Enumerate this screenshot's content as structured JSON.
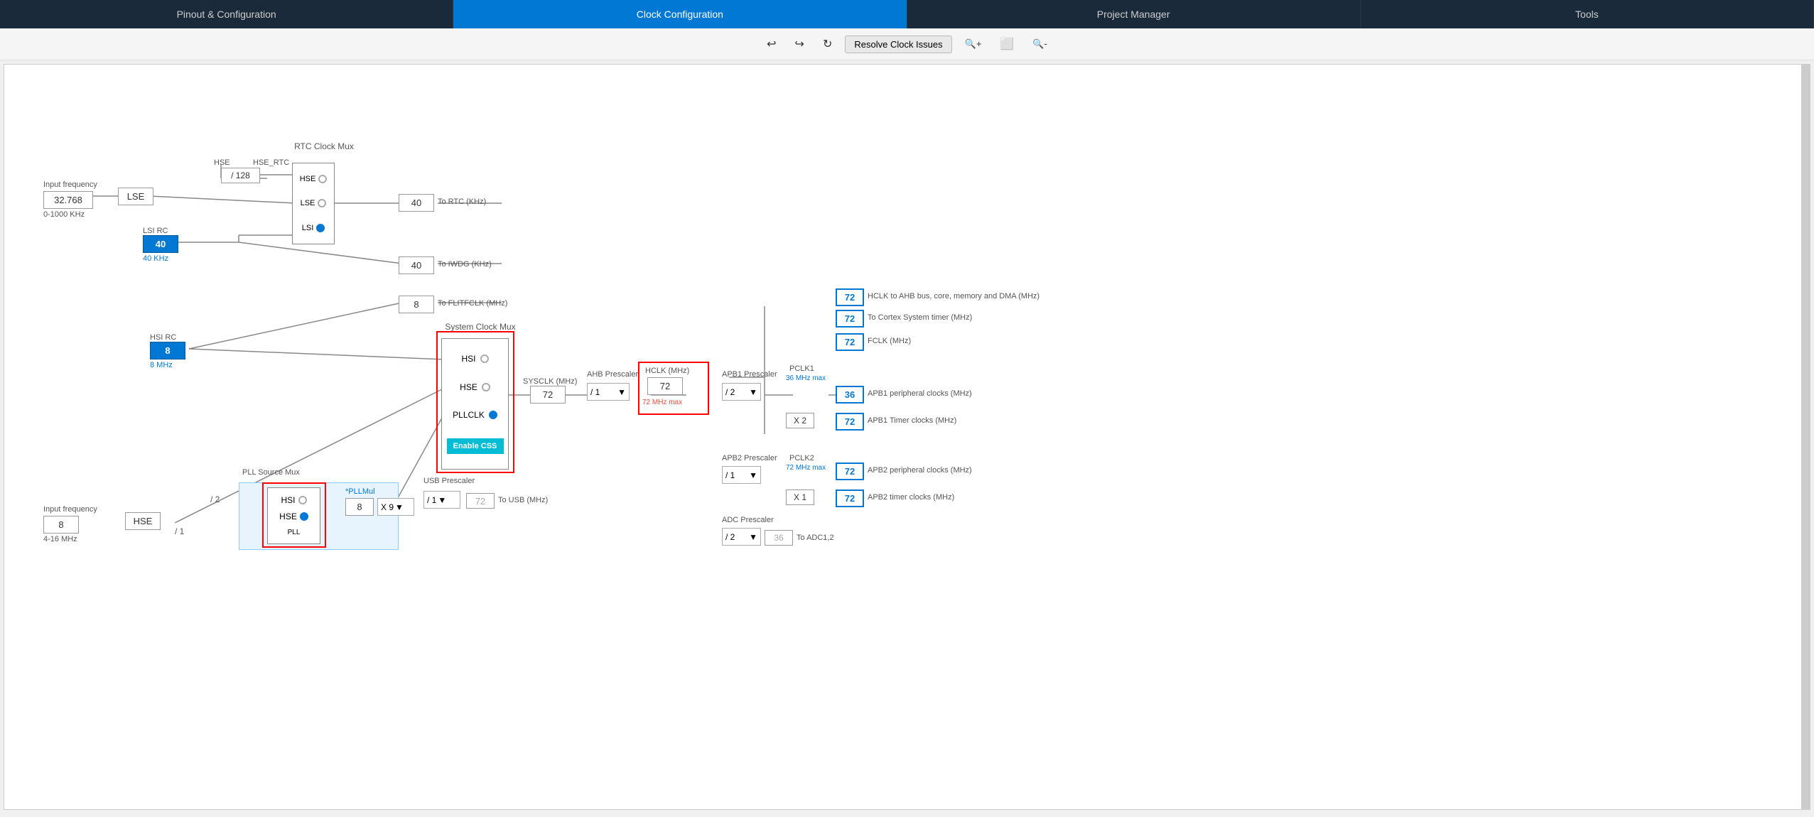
{
  "nav": {
    "tabs": [
      {
        "label": "Pinout & Configuration",
        "active": false
      },
      {
        "label": "Clock Configuration",
        "active": true
      },
      {
        "label": "Project Manager",
        "active": false
      },
      {
        "label": "Tools",
        "active": false
      }
    ]
  },
  "toolbar": {
    "undo_icon": "↩",
    "redo_icon": "↪",
    "refresh_icon": "↻",
    "resolve_label": "Resolve Clock Issues",
    "zoom_in_icon": "🔍",
    "zoom_fit_icon": "⬜",
    "zoom_out_icon": "🔍"
  },
  "diagram": {
    "rtc_mux_label": "RTC Clock Mux",
    "system_mux_label": "System Clock Mux",
    "pll_source_mux_label": "PLL Source Mux",
    "usb_prescaler_label": "USB Prescaler",
    "apb1_prescaler_label": "APB1 Prescaler",
    "apb2_prescaler_label": "APB2 Prescaler",
    "adc_prescaler_label": "ADC Prescaler",
    "input_freq_label_1": "Input frequency",
    "input_freq_val_1": "32.768",
    "input_freq_range_1": "0-1000 KHz",
    "input_freq_label_2": "Input frequency",
    "input_freq_val_2": "8",
    "input_freq_range_2": "4-16 MHz",
    "lse_label": "LSE",
    "lsi_rc_label": "LSI RC",
    "lsi_rc_val": "40",
    "lsi_rc_unit": "40 KHz",
    "hsi_rc_label": "HSI RC",
    "hsi_rc_val": "8",
    "hsi_rc_unit": "8 MHz",
    "hse_label": "HSE",
    "hse_rtc_label": "HSE_RTC",
    "div128_label": "/ 128",
    "lse_mux_input": "LSE",
    "lsi_mux_input": "LSI",
    "hsi_mux_input": "HSI",
    "hse_sys_input": "HSE",
    "pllclk_input": "PLLCLK",
    "rtc_out_val": "40",
    "rtc_out_label": "To RTC (KHz)",
    "iwdg_out_val": "40",
    "iwdg_out_label": "To IWDG (KHz)",
    "flitf_out_val": "8",
    "flitf_out_label": "To FLITFCLK (MHz)",
    "sysclk_label": "SYSCLK (MHz)",
    "sysclk_val": "72",
    "ahb_prescaler_label": "AHB Prescaler",
    "ahb_div": "/ 1",
    "hclk_label": "HCLK (MHz)",
    "hclk_val": "72",
    "hclk_max": "72 MHz max",
    "hclk_ahb_val": "72",
    "hclk_ahb_label": "HCLK to AHB bus, core, memory and DMA (MHz)",
    "cortex_timer_val": "72",
    "cortex_timer_label": "To Cortex System timer (MHz)",
    "fclk_val": "72",
    "fclk_label": "FCLK (MHz)",
    "pclk1_label": "PCLK1",
    "pclk1_max": "36 MHz max",
    "apb1_div": "/ 2",
    "apb1_periph_val": "36",
    "apb1_periph_label": "APB1 peripheral clocks (MHz)",
    "apb1_timer_mult": "X 2",
    "apb1_timer_val": "72",
    "apb1_timer_label": "APB1 Timer clocks (MHz)",
    "pclk2_label": "PCLK2",
    "pclk2_max": "72 MHz max",
    "apb2_div": "/ 1",
    "apb2_periph_val": "72",
    "apb2_periph_label": "APB2 peripheral clocks (MHz)",
    "apb2_timer_mult": "X 1",
    "apb2_timer_val": "72",
    "apb2_timer_label": "APB2 timer clocks (MHz)",
    "adc_div": "/ 2",
    "adc_out_val": "36",
    "adc_out_label": "To ADC1,2",
    "pll_div2": "/ 2",
    "pll_div1": "/ 1",
    "pll_mul_label": "*PLLMul",
    "pll_mul_val": "8",
    "pll_mul_x9": "X 9",
    "usb_div1": "/ 1",
    "usb_out_val": "72",
    "usb_out_label": "To USB (MHz)",
    "enable_css_label": "Enable CSS",
    "pll_label": "PLL"
  }
}
